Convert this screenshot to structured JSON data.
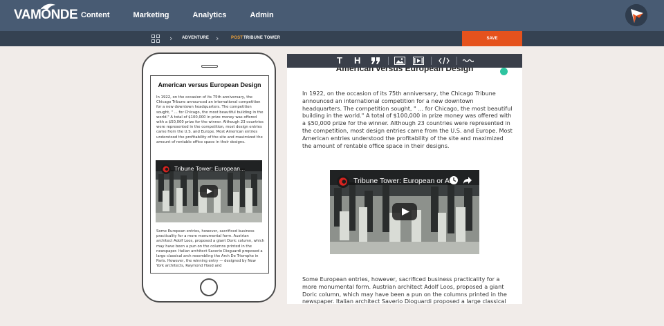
{
  "app": {
    "logo": "VAMONDE",
    "nav": [
      "Content",
      "Marketing",
      "Analytics",
      "Admin"
    ]
  },
  "breadcrumb": {
    "items": [
      "ADVENTURE"
    ],
    "post_tag": "POST",
    "post_title": "TRIBUNE TOWER"
  },
  "toolbar": {
    "save_label": "SAVE",
    "buttons": [
      "T",
      "H",
      "quote-icon",
      "image-icon",
      "video-icon",
      "code-icon",
      "divider-icon"
    ]
  },
  "article": {
    "title": "American versus European Design",
    "paragraph1": "In 1922, on the occasion of its 75th anniversary, the Chicago Tribune announced an international competition for a new downtown headquarters. The competition sought, \" ... for Chicago, the most beautiful building in the world.\" A total of $100,000 in prize money was offered with a $50,000 prize for the winner. Although 23 countries were represented in the competition, most design entries came from the U.S. and Europe. Most American entries understood the profitability of the site and maximized the amount of rentable office space in their designs.",
    "paragraph2": "Some European entries, however, sacrificed business practicality for a more monumental form. Austrian architect Adolf Loos, proposed a giant Doric column, which may have been a pun on the columns printed in the newspaper. Italian architect Saverio Dioguardi proposed a large classical arch resembling the Arch De Triomphe in Paris. However, the winning entry — designed by New York architects, Raymond Hood and",
    "video_title_mobile": "Tribune Tower: European...",
    "video_title_desktop": "Tribune Tower: European or A..."
  },
  "colors": {
    "topbar": "#485b73",
    "crumbbar": "#354252",
    "accent": "#e5521d",
    "post_tag": "#f2a33a",
    "toolbar": "#3a3f4a"
  }
}
